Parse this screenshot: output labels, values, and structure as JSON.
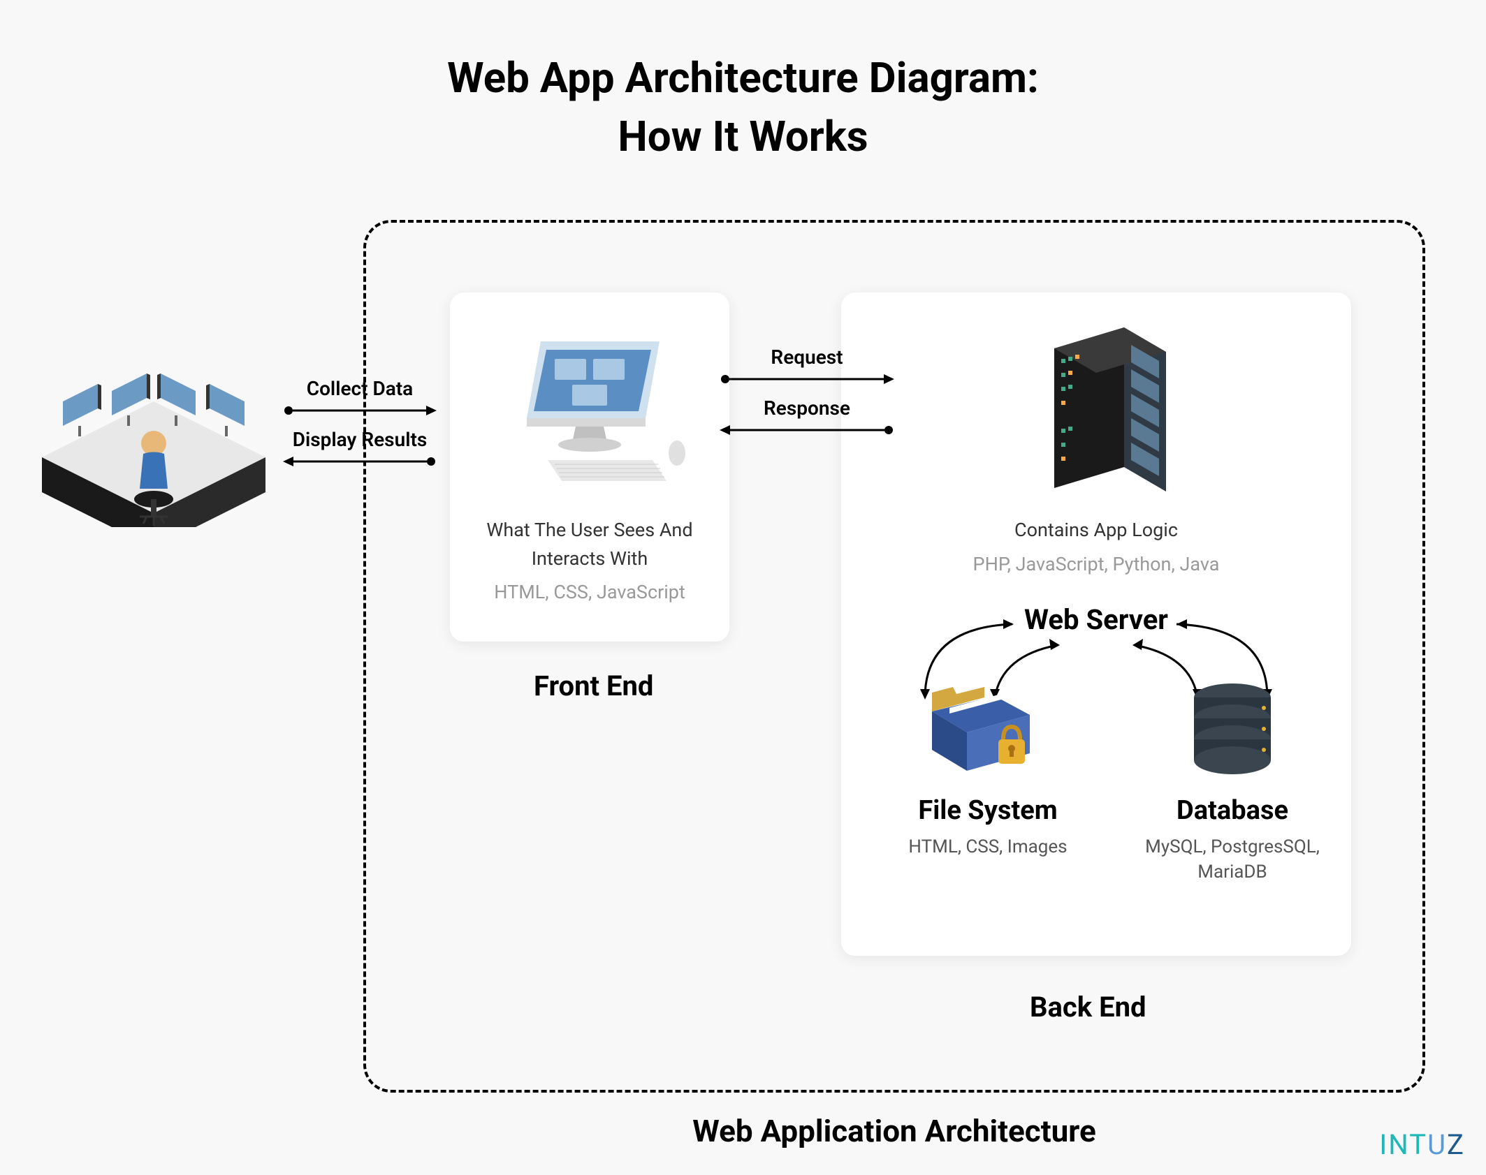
{
  "title_line1": "Web App Architecture Diagram:",
  "title_line2": "How It Works",
  "architecture_label": "Web Application Architecture",
  "user_to_frontend": {
    "top_label": "Collect Data",
    "bottom_label": "Display Results"
  },
  "frontend": {
    "label": "Front End",
    "description": "What The User Sees And Interacts With",
    "tech": "HTML, CSS, JavaScript"
  },
  "frontend_to_backend": {
    "top_label": "Request",
    "bottom_label": "Response"
  },
  "backend": {
    "label": "Back End",
    "server_desc": "Contains App Logic",
    "server_tech": "PHP, JavaScript, Python, Java",
    "webserver_label": "Web Server",
    "filesystem": {
      "title": "File System",
      "tech": "HTML, CSS, Images"
    },
    "database": {
      "title": "Database",
      "tech": "MySQL, PostgresSQL, MariaDB"
    }
  },
  "brand": "INTUZ"
}
